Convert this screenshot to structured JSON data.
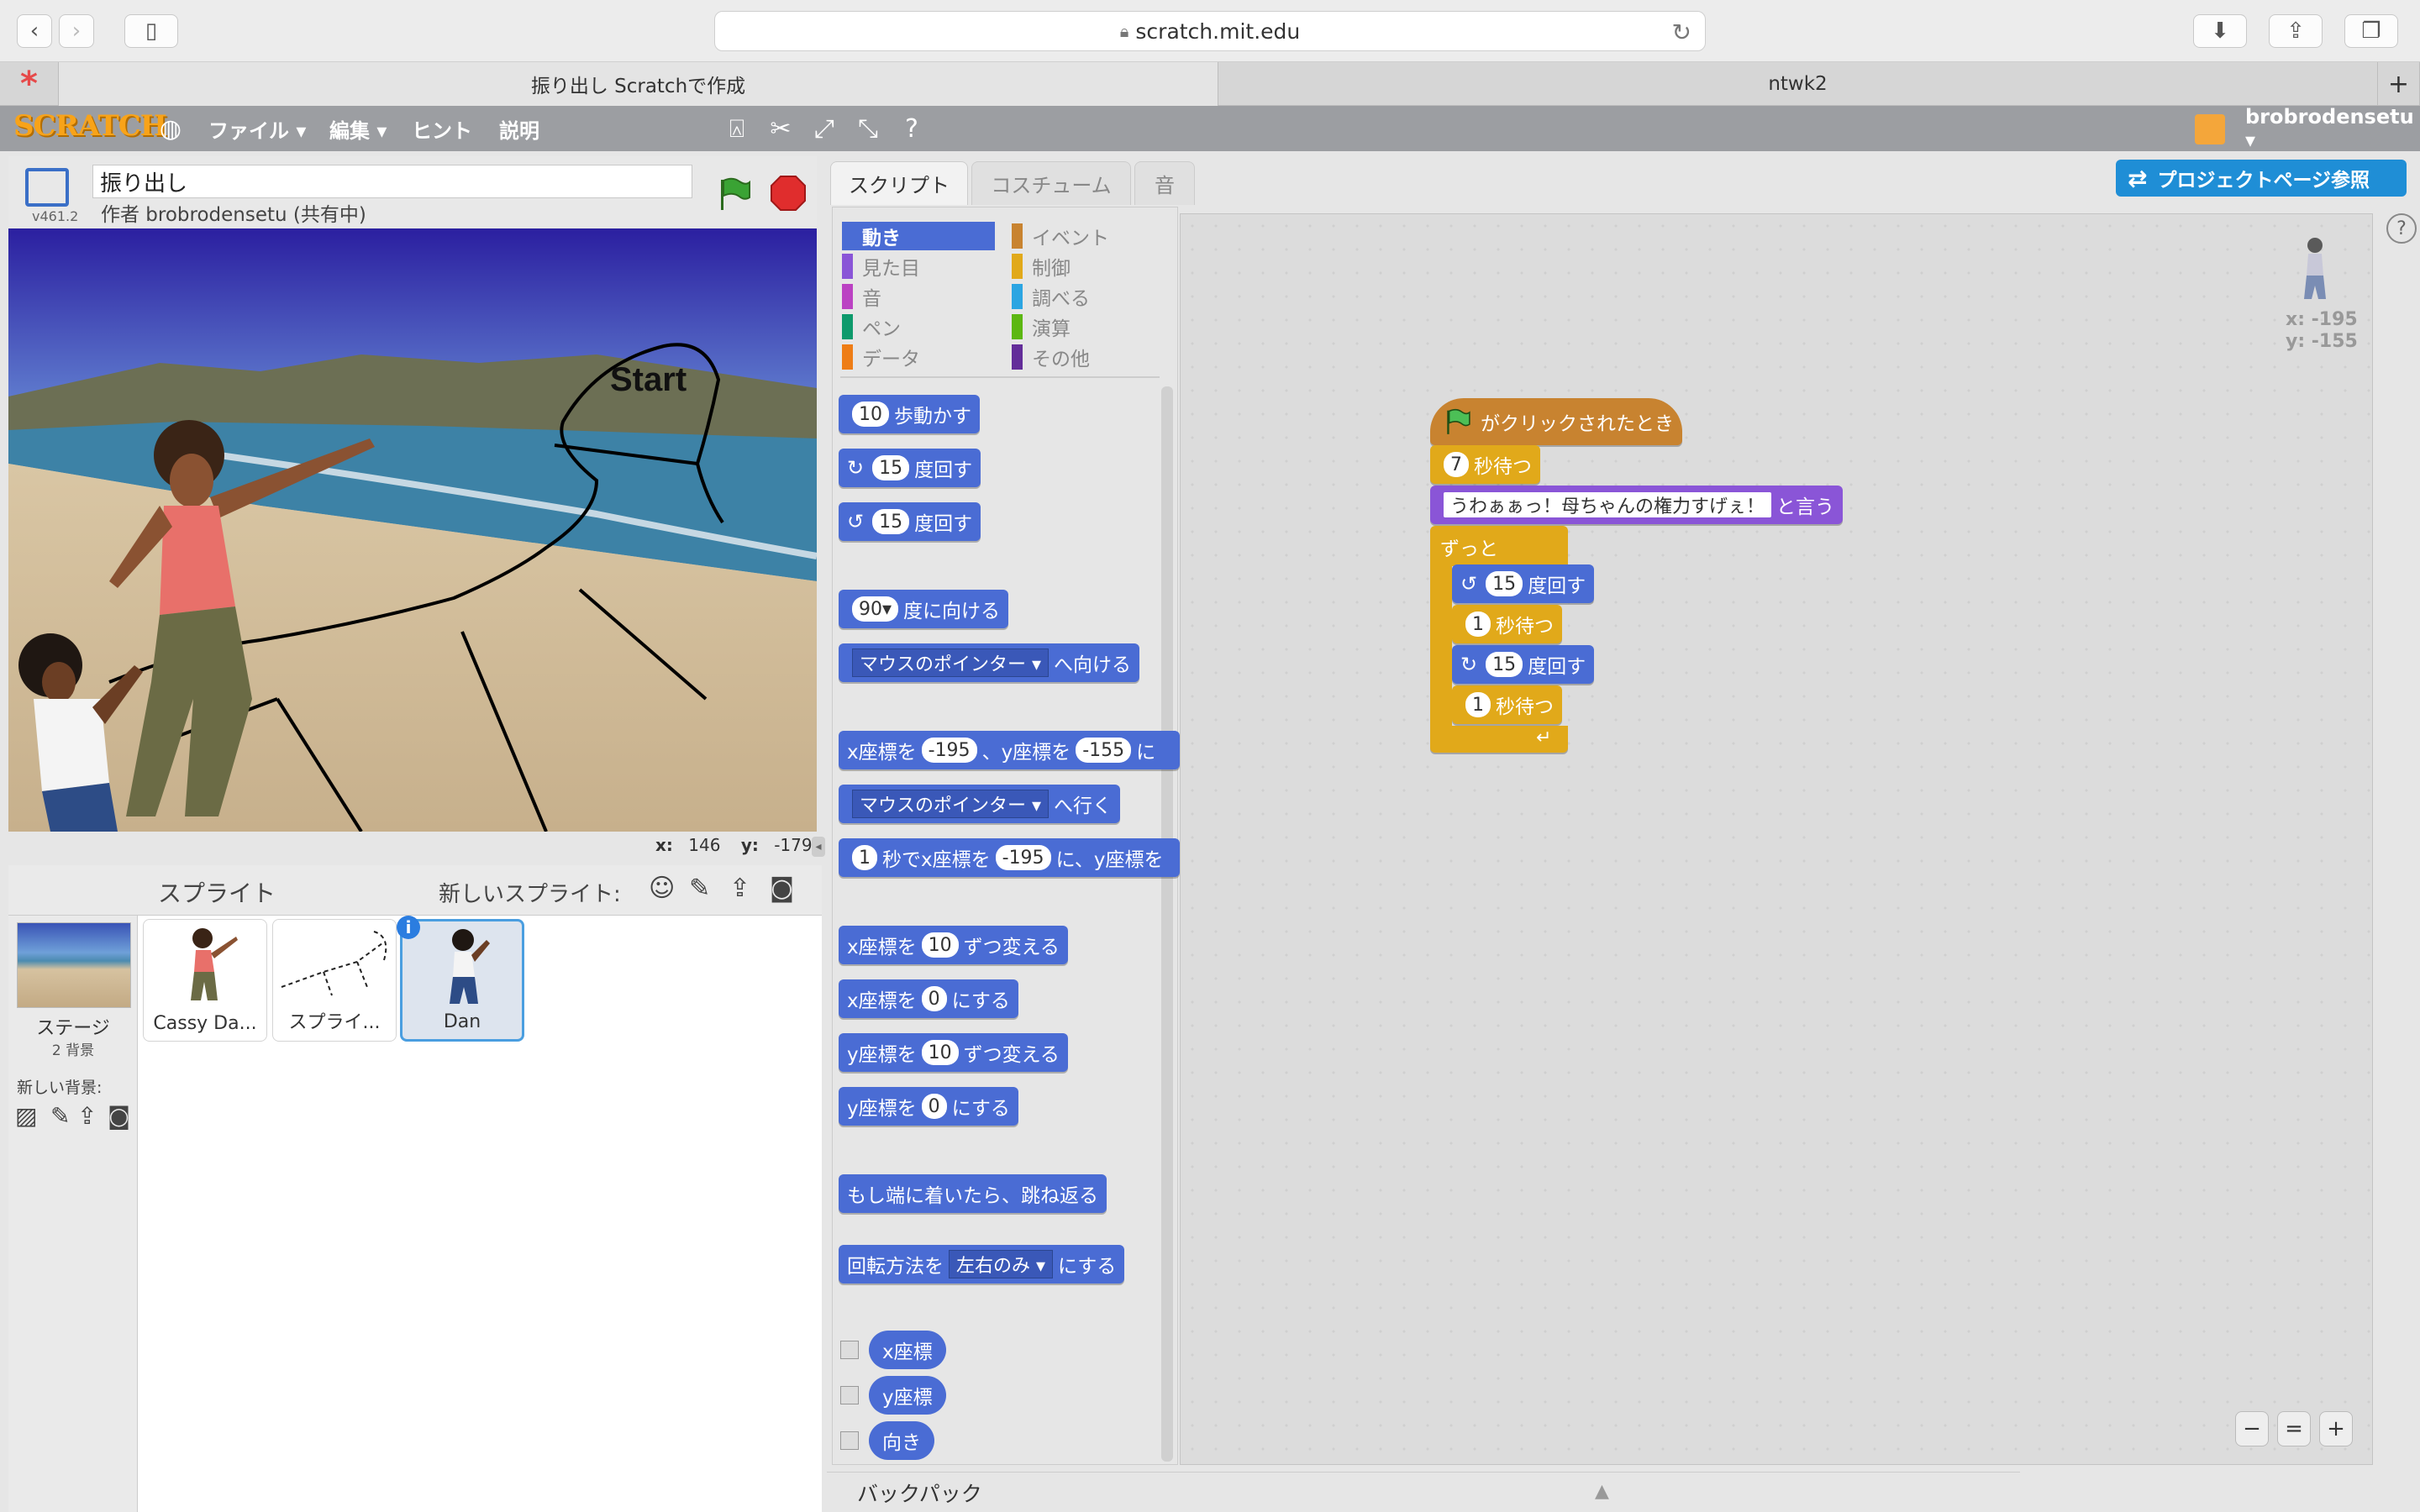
{
  "browser": {
    "url": "scratch.mit.edu",
    "tabs": [
      {
        "label": "振り出し Scratchで作成",
        "active": true
      },
      {
        "label": "ntwk2",
        "active": false
      }
    ],
    "new_tab": "+"
  },
  "menubar": {
    "logo": "SCRATCH",
    "file": "ファイル ▾",
    "edit": "編集 ▾",
    "tips": "ヒント",
    "about": "説明",
    "user": "brobrodensetu ▾"
  },
  "stage": {
    "project_title": "振り出し",
    "author": "作者 brobrodensetu (共有中)",
    "version": "v461.2",
    "stage_text": "Start",
    "mouse_x_label": "x:",
    "mouse_x": "146",
    "mouse_y_label": "y:",
    "mouse_y": "-179"
  },
  "sprites": {
    "header": "スプライト",
    "new_sprite": "新しいスプライト:",
    "stage_label": "ステージ",
    "stage_backdrops": "2 背景",
    "new_backdrop": "新しい背景:",
    "items": [
      {
        "label": "Cassy Da..."
      },
      {
        "label": "スプライ..."
      },
      {
        "label": "Dan"
      }
    ]
  },
  "editor": {
    "tabs": [
      "スクリプト",
      "コスチューム",
      "音"
    ],
    "project_page": "プロジェクトページ参照",
    "categories_left": [
      "動き",
      "見た目",
      "音",
      "ペン",
      "データ"
    ],
    "categories_right": [
      "イベント",
      "制御",
      "調べる",
      "演算",
      "その他"
    ],
    "category_colors_left": [
      "#4a6cd4",
      "#8a55d7",
      "#bb42c3",
      "#0e9a6c",
      "#ee7d16"
    ],
    "category_colors_right": [
      "#c88330",
      "#e1a91a",
      "#2ca5e2",
      "#5cb712",
      "#632d99"
    ],
    "palette": {
      "move_num": "10",
      "move_txt": "歩動かす",
      "turn_num": "15",
      "turn_txt": "度回す",
      "point_num": "90▾",
      "point_txt": "度に向ける",
      "pointto_dd": "マウスのポインター ▾",
      "pointto_txt": "へ向ける",
      "goto_x_pre": "x座標を",
      "goto_x": "-195",
      "goto_y_pre": "、y座標を",
      "goto_y": "-155",
      "goto_end": "に",
      "goto_dd": "マウスのポインター ▾",
      "goto_txt": "へ行く",
      "glide_num": "1",
      "glide_txt": "秒でx座標を",
      "glide_x": "-195",
      "glide_mid": "に、y座標を",
      "chx_pre": "x座標を",
      "chx_num": "10",
      "chx_txt": "ずつ変える",
      "setx_pre": "x座標を",
      "setx_num": "0",
      "setx_txt": "にする",
      "chy_pre": "y座標を",
      "chy_num": "10",
      "chy_txt": "ずつ変える",
      "sety_pre": "y座標を",
      "sety_num": "0",
      "sety_txt": "にする",
      "bounce": "もし端に着いたら、跳ね返る",
      "rot_pre": "回転方法を",
      "rot_dd": "左右のみ ▾",
      "rot_txt": "にする",
      "rep_x": "x座標",
      "rep_y": "y座標",
      "rep_dir": "向き"
    },
    "sprite_x": "x: -195",
    "sprite_y": "y: -155",
    "script": {
      "hat": "がクリックされたとき",
      "wait1_num": "7",
      "wait_txt": "秒待つ",
      "say_text": "うわぁぁっ！母ちゃんの権力すげぇ！",
      "say_txt": "と言う",
      "forever": "ずっと",
      "turn_l_num": "15",
      "turn_txt": "度回す",
      "wait2_num": "1",
      "turn_r_num": "15",
      "wait3_num": "1"
    },
    "backpack": "バックパック"
  }
}
